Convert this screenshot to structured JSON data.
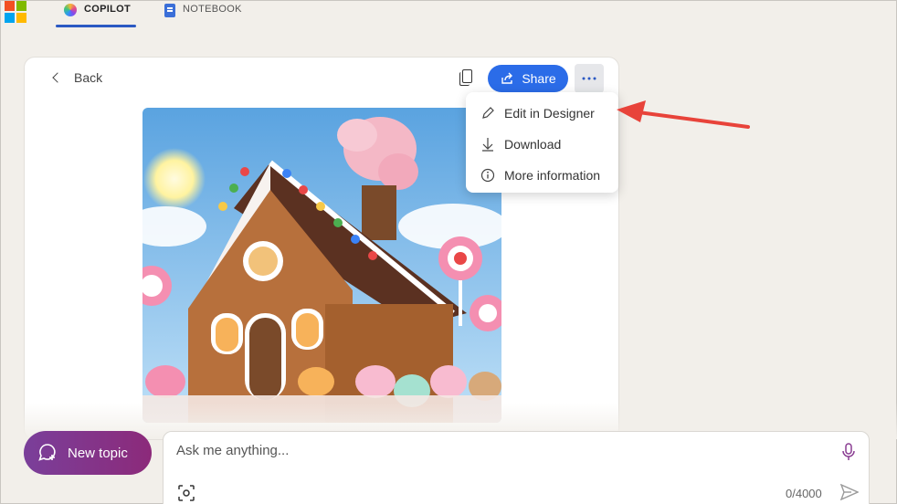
{
  "header": {
    "tabs": [
      {
        "label": "COPILOT",
        "icon": "copilot-icon",
        "active": true
      },
      {
        "label": "NOTEBOOK",
        "icon": "notebook-icon",
        "active": false
      }
    ],
    "accent_color": "#2b59c3"
  },
  "card": {
    "back_label": "Back",
    "share_label": "Share",
    "share_color": "#2b6ce8"
  },
  "menu": {
    "items": [
      {
        "label": "Edit in Designer",
        "icon": "pencil-icon"
      },
      {
        "label": "Download",
        "icon": "download-icon"
      },
      {
        "label": "More information",
        "icon": "info-icon"
      }
    ]
  },
  "composer": {
    "new_topic_label": "New topic",
    "placeholder": "Ask me anything...",
    "char_counter": "0/4000"
  },
  "annotation": {
    "arrow_color": "#e8433a"
  }
}
